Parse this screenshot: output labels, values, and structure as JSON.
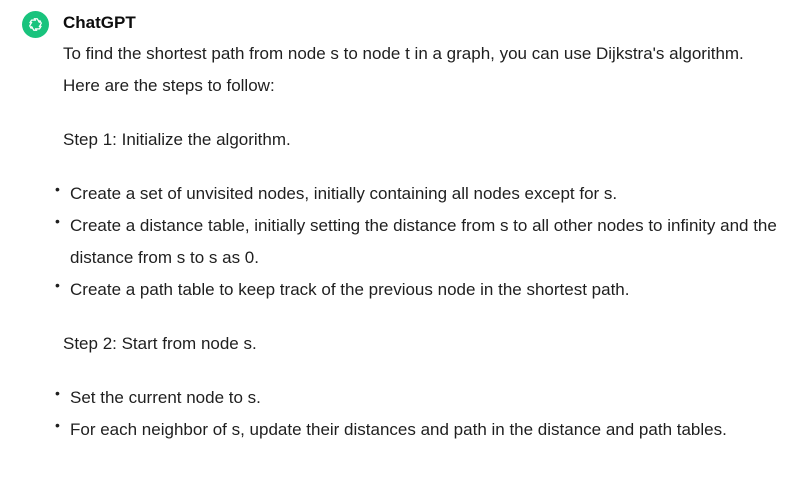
{
  "message": {
    "author": "ChatGPT",
    "avatar_icon": "openai-logo-icon",
    "avatar_color": "#19c37d",
    "intro": "To find the shortest path from node s to node t in a graph, you can use Dijkstra's algorithm. Here are the steps to follow:",
    "step1": {
      "heading": "Step 1: Initialize the algorithm.",
      "bullets": [
        "Create a set of unvisited nodes, initially containing all nodes except for s.",
        "Create a distance table, initially setting the distance from s to all other nodes to infinity and the distance from s to s as 0.",
        "Create a path table to keep track of the previous node in the shortest path."
      ]
    },
    "step2": {
      "heading": "Step 2: Start from node s.",
      "bullets": [
        "Set the current node to s.",
        "For each neighbor of s, update their distances and path in the distance and path tables."
      ]
    }
  }
}
